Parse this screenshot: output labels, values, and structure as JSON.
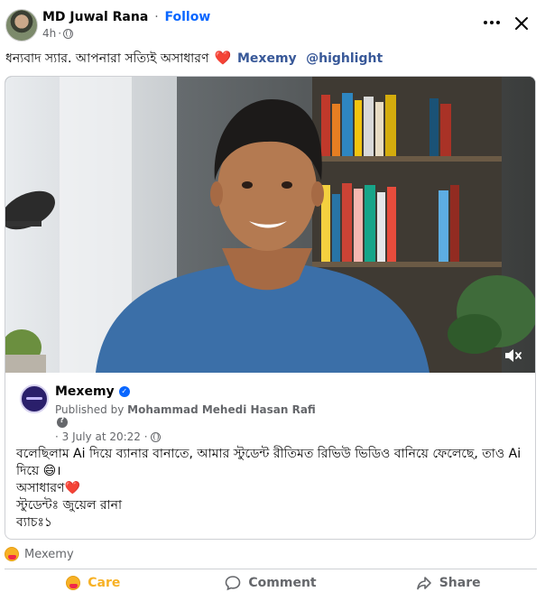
{
  "post": {
    "author": "MD Juwal Rana",
    "separator": "·",
    "follow_label": "Follow",
    "time": "4h",
    "time_sep": "·",
    "text": "ধন্যবাদ স্যার. আপনারা সত্যিই অসাধারণ",
    "heart": "❤️",
    "mentions": [
      "Mexemy",
      "@highlight"
    ]
  },
  "shared": {
    "page_name": "Mexemy",
    "published_prefix": "Published by",
    "published_by": "Mohammad Mehedi Hasan Rafi",
    "date": "· 3 July at 20:22 ·",
    "body_lines": [
      "বলেছিলাম Ai দিয়ে ব্যানার বানাতে, আমার স্টুডেন্ট রীতিমত রিভিউ ভিডিও বানিয়ে ফেলেছে, তাও Ai",
      "দিয়ে 😄।",
      "অসাধারণ❤️",
      "স্টুডেন্টঃ জুয়েল রানা",
      "ব্যাচঃ১"
    ]
  },
  "reactions": {
    "label": "Mexemy"
  },
  "actions": {
    "care": "Care",
    "comment": "Comment",
    "share": "Share"
  },
  "icons": {
    "more": "more-icon",
    "close": "close-icon",
    "globe": "globe-icon",
    "mute": "speaker-muted-icon",
    "verified": "verified-icon"
  },
  "colors": {
    "link": "#0866ff",
    "mention": "#385898",
    "secondary_text": "#65676b",
    "border": "#ced0d4",
    "care": "#f7b125",
    "heart": "#e41e3f"
  }
}
